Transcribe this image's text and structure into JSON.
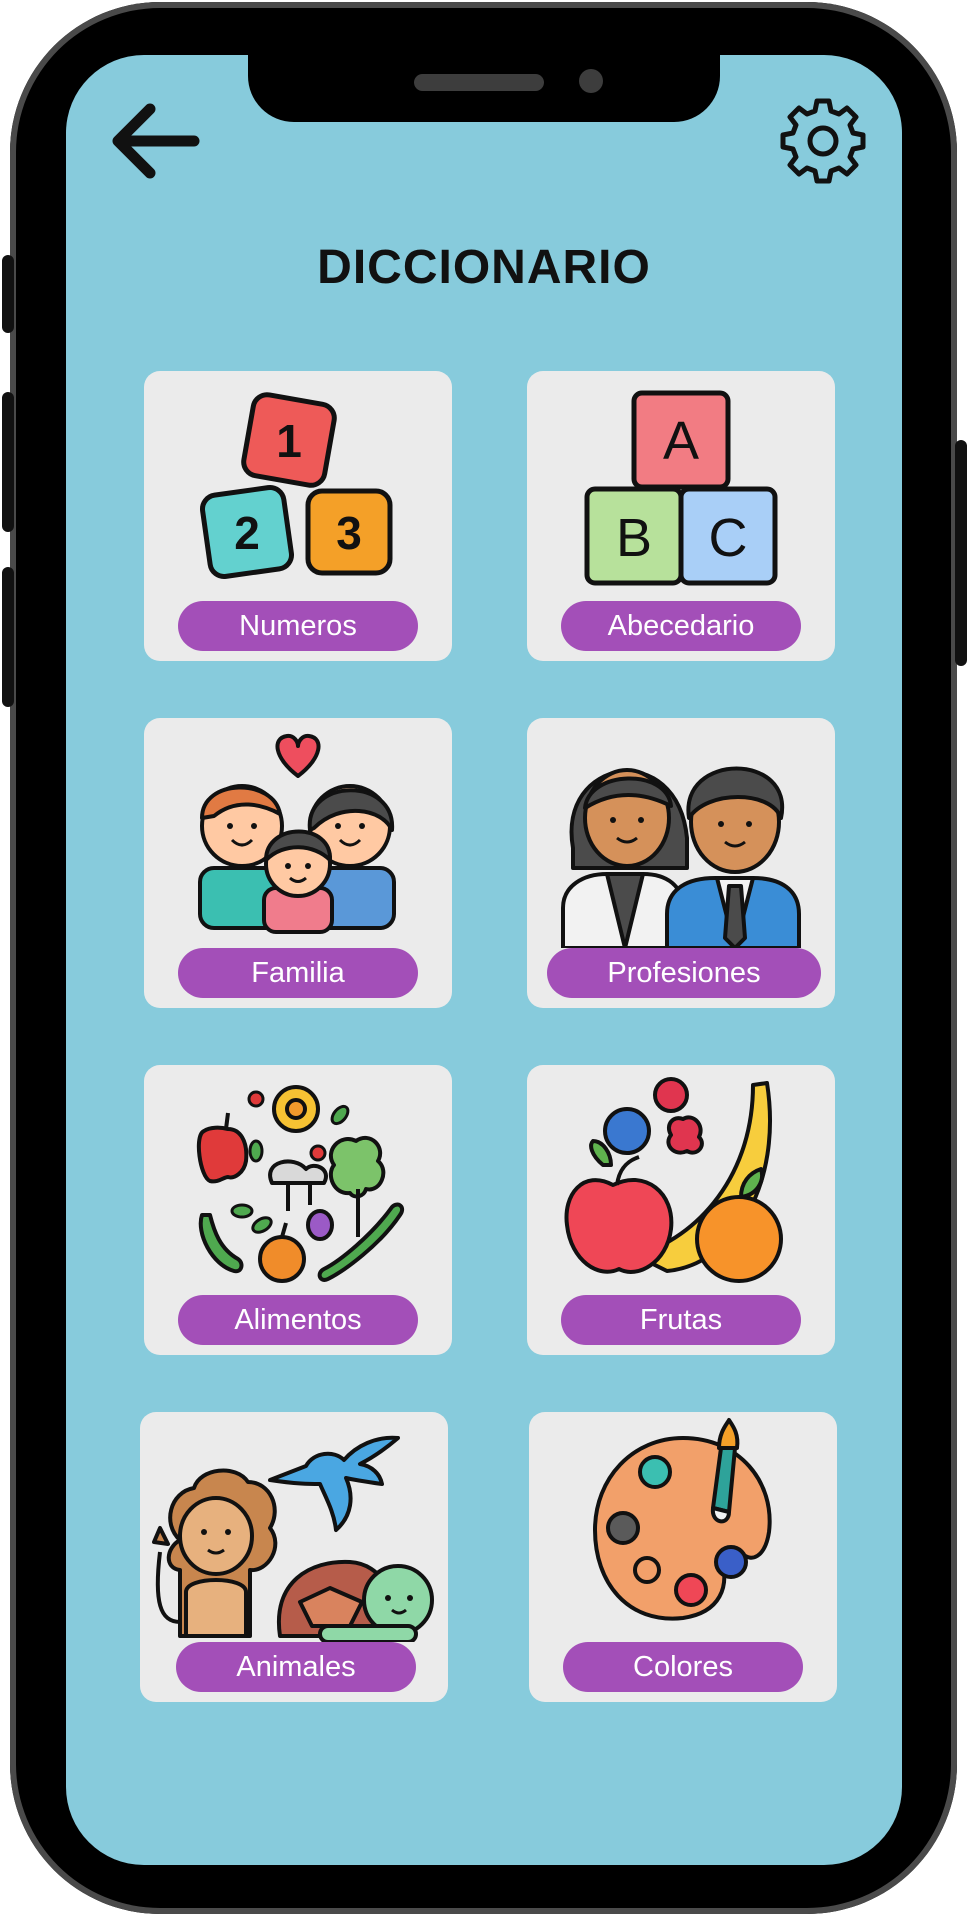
{
  "header": {
    "title": "DICCIONARIO",
    "back_icon": "arrow-left-icon",
    "settings_icon": "gear-icon"
  },
  "categories": [
    {
      "label": "Numeros",
      "icon": "number-blocks-icon"
    },
    {
      "label": "Abecedario",
      "icon": "alphabet-blocks-icon"
    },
    {
      "label": "Familia",
      "icon": "family-icon"
    },
    {
      "label": "Profesiones",
      "icon": "professionals-icon"
    },
    {
      "label": "Alimentos",
      "icon": "vegetables-icon"
    },
    {
      "label": "Frutas",
      "icon": "fruits-icon"
    },
    {
      "label": "Animales",
      "icon": "animals-icon"
    },
    {
      "label": "Colores",
      "icon": "paint-palette-icon"
    }
  ],
  "colors": {
    "screen_background": "#87cbdc",
    "card_background": "#ebebeb",
    "label_background": "#a34fb8",
    "label_text": "#ffffff"
  }
}
